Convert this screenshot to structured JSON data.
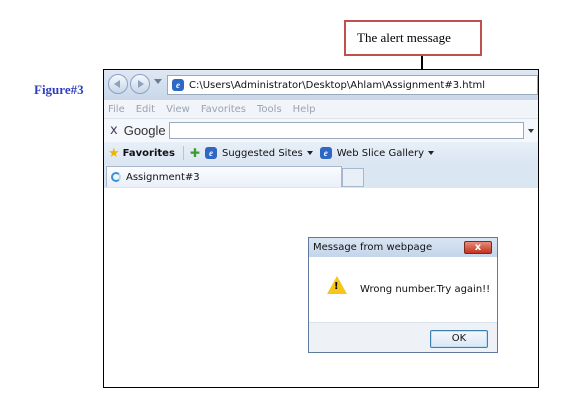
{
  "figure_label": "Figure#3",
  "callout": {
    "text": "The alert message"
  },
  "browser": {
    "address": "C:\\Users\\Administrator\\Desktop\\Ahlam\\Assignment#3.html",
    "menu": [
      "File",
      "Edit",
      "View",
      "Favorites",
      "Tools",
      "Help"
    ],
    "google_toolbar": {
      "close": "x",
      "logo": "Google"
    },
    "favorites_bar": {
      "favorites_label": "Favorites",
      "items": [
        "Suggested Sites",
        "Web Slice Gallery"
      ]
    },
    "tab": {
      "title": "Assignment#3"
    }
  },
  "dialog": {
    "title": "Message from webpage",
    "close": "x",
    "message": "Wrong number.Try again!!",
    "ok_label": "OK"
  },
  "colors": {
    "figure_label": "#2f3fc0",
    "callout_border": "#c0504d",
    "warning_icon": "#f6c61a",
    "close_button": "#c1331f"
  },
  "icons": [
    "back-icon",
    "forward-icon",
    "ie-page-icon",
    "star-icon",
    "add-favorites-icon",
    "loading-icon",
    "warning-icon",
    "close-icon",
    "down-arrow-icon"
  ]
}
